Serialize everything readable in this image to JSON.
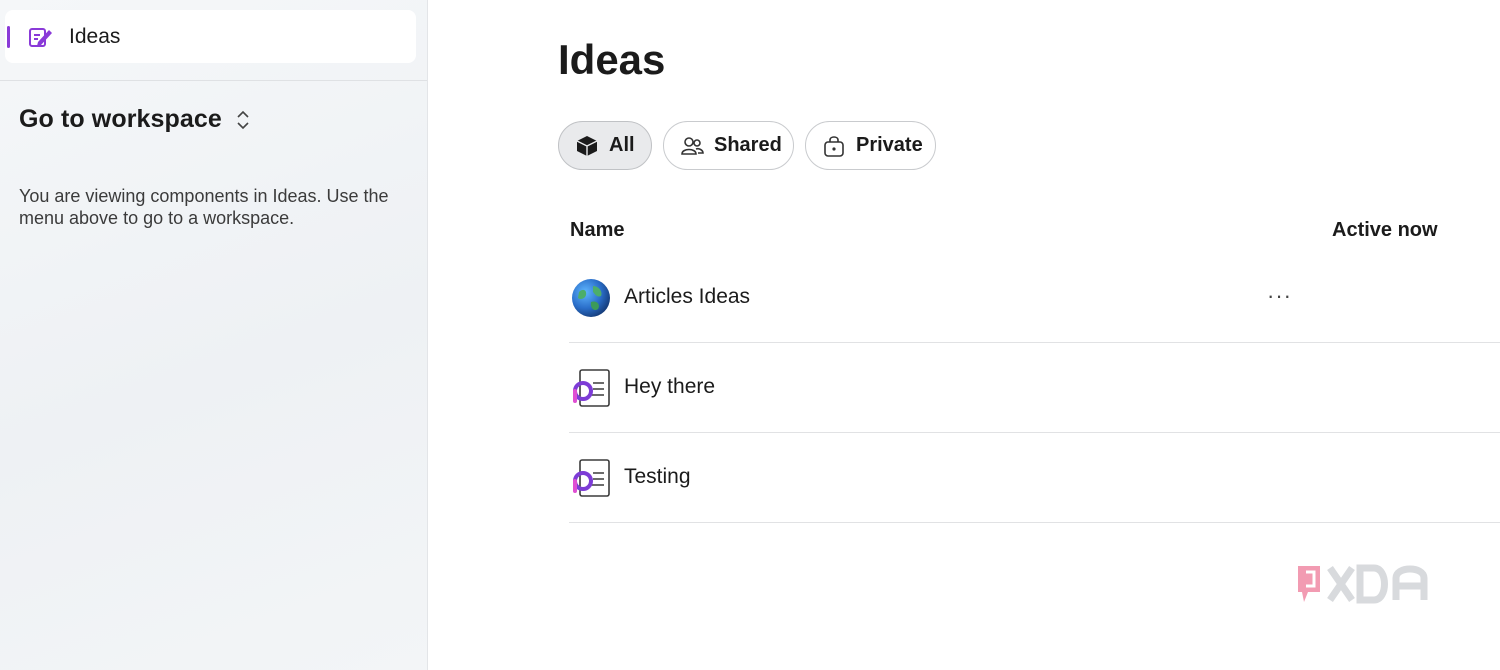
{
  "sidebar": {
    "nav_item": {
      "label": "Ideas",
      "icon": "pencil-note-icon"
    },
    "workspace": {
      "label": "Go to workspace",
      "icon": "chevron-updown-icon"
    },
    "info_text": "You are viewing components in Ideas. Use the menu above to go to a workspace."
  },
  "main": {
    "title": "Ideas",
    "filters": [
      {
        "label": "All",
        "icon": "box-icon",
        "active": true
      },
      {
        "label": "Shared",
        "icon": "people-icon",
        "active": false
      },
      {
        "label": "Private",
        "icon": "lock-bag-icon",
        "active": false
      }
    ],
    "columns": {
      "name": "Name",
      "active": "Active now"
    },
    "rows": [
      {
        "title": "Articles Ideas",
        "icon": "globe-icon",
        "more": "···"
      },
      {
        "title": "Hey there",
        "icon": "loop-page-icon"
      },
      {
        "title": "Testing",
        "icon": "loop-page-icon"
      }
    ]
  },
  "watermark": {
    "text": "XDA",
    "icon": "xda-logo"
  },
  "colors": {
    "accent": "#8a3ad8",
    "loop_purple": "#7d3cd6",
    "loop_pink": "#e04fd3"
  }
}
